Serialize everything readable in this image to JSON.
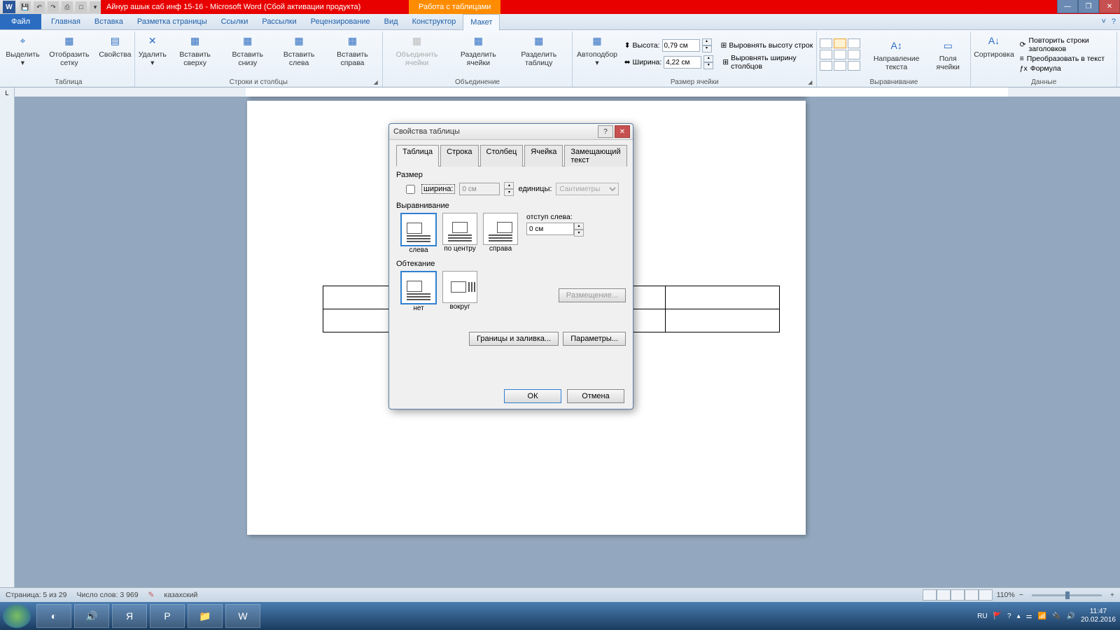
{
  "titlebar": {
    "doc_title": "Айнур ашык саб инф 15-16  -  Microsoft Word (Сбой активации продукта)",
    "tools_context": "Работа с таблицами"
  },
  "ribbon_tabs": {
    "file": "Файл",
    "items": [
      "Главная",
      "Вставка",
      "Разметка страницы",
      "Ссылки",
      "Рассылки",
      "Рецензирование",
      "Вид",
      "Конструктор",
      "Макет"
    ]
  },
  "ribbon": {
    "group_table": {
      "label": "Таблица",
      "select": "Выделить",
      "grid": "Отобразить сетку",
      "props": "Свойства"
    },
    "group_rowscols": {
      "label": "Строки и столбцы",
      "delete": "Удалить",
      "ins_above": "Вставить сверху",
      "ins_below": "Вставить снизу",
      "ins_left": "Вставить слева",
      "ins_right": "Вставить справа"
    },
    "group_merge": {
      "label": "Объединение",
      "merge": "Объединить ячейки",
      "split_cells": "Разделить ячейки",
      "split_table": "Разделить таблицу"
    },
    "group_cellsize": {
      "label": "Размер ячейки",
      "autofit": "Автоподбор",
      "height_label": "Высота:",
      "height_value": "0,79 см",
      "width_label": "Ширина:",
      "width_value": "4,22 см",
      "dist_rows": "Выровнять высоту строк",
      "dist_cols": "Выровнять ширину столбцов"
    },
    "group_align": {
      "label": "Выравнивание",
      "text_dir": "Направление текста",
      "margins": "Поля ячейки"
    },
    "group_data": {
      "label": "Данные",
      "sort": "Сортировка",
      "repeat": "Повторить строки заголовков",
      "convert": "Преобразовать в текст",
      "formula": "Формула"
    }
  },
  "dialog": {
    "title": "Свойства таблицы",
    "tabs": [
      "Таблица",
      "Строка",
      "Столбец",
      "Ячейка",
      "Замещающий текст"
    ],
    "size_label": "Размер",
    "width_label": "ширина:",
    "width_value": "0 см",
    "units_label": "единицы:",
    "units_value": "Сантиметры",
    "align_label": "Выравнивание",
    "align_left": "слева",
    "align_center": "по центру",
    "align_right": "справа",
    "indent_label": "отступ слева:",
    "indent_value": "0 см",
    "wrap_label": "Обтекание",
    "wrap_none": "нет",
    "wrap_around": "вокруг",
    "placement": "Размещение...",
    "borders": "Границы и заливка...",
    "params": "Параметры...",
    "ok": "ОК",
    "cancel": "Отмена"
  },
  "statusbar": {
    "page": "Страница: 5 из 29",
    "words": "Число слов: 3 969",
    "lang": "казахский",
    "zoom": "110%"
  },
  "taskbar": {
    "lang": "RU",
    "time": "11:47",
    "date": "20.02.2016"
  }
}
